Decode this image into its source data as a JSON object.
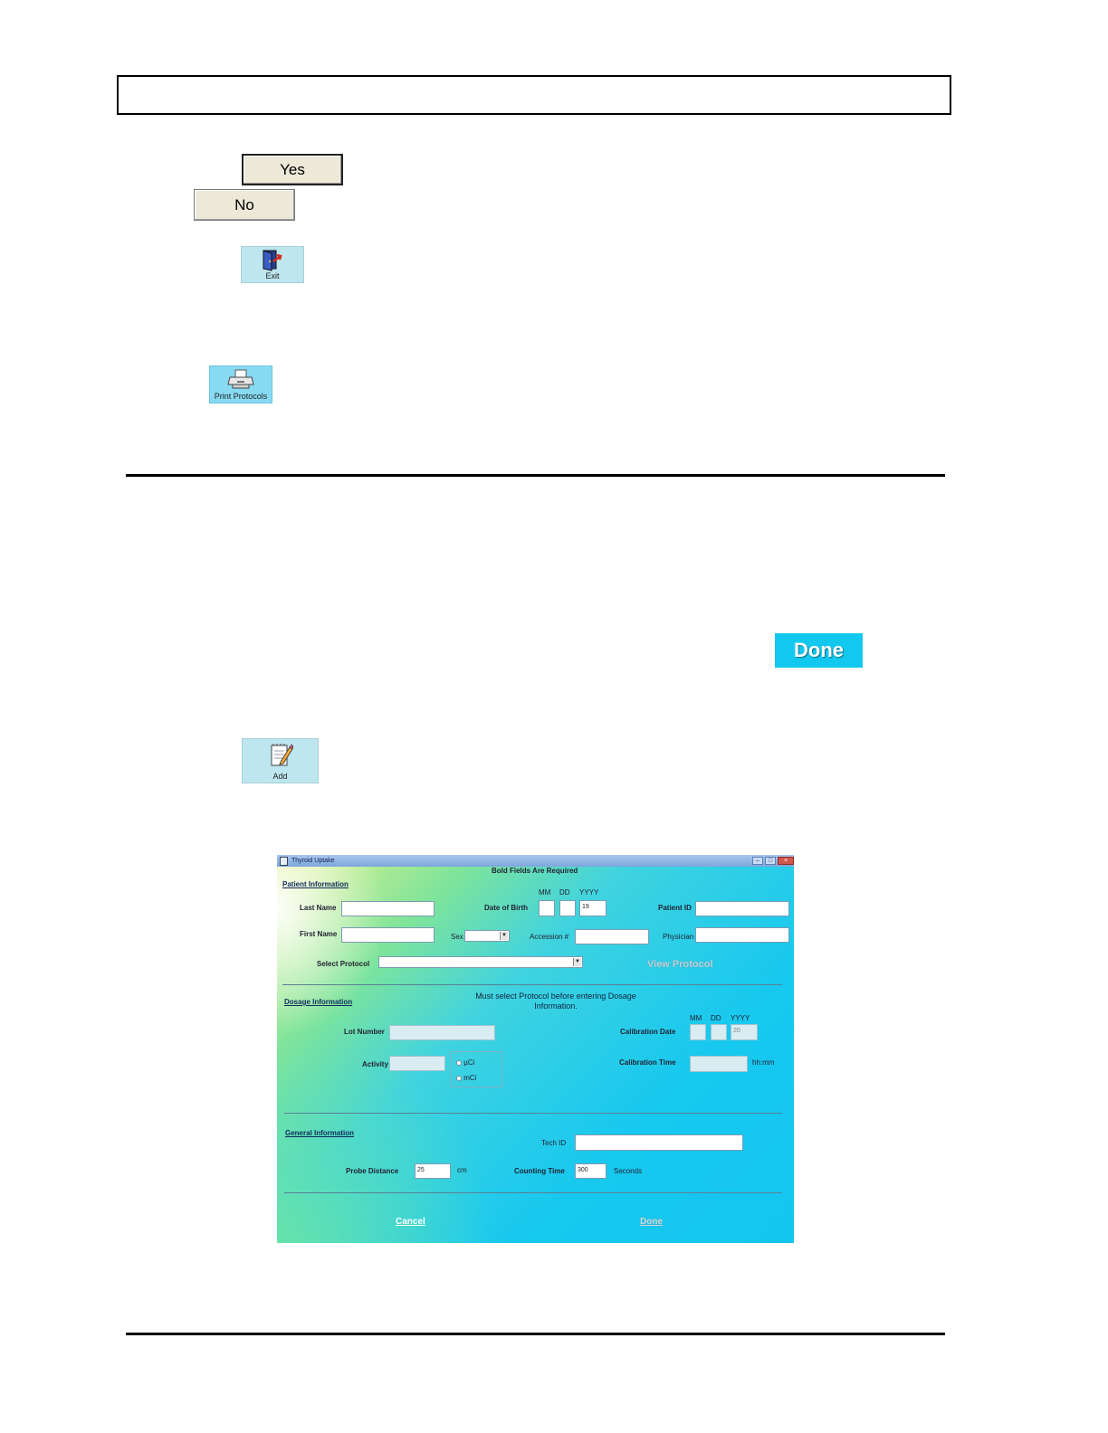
{
  "buttons": {
    "yes": "Yes",
    "no": "No",
    "exit": "Exit",
    "print_protocols": "Print Protocols",
    "done": "Done",
    "add": "Add"
  },
  "dialog": {
    "title": "Thyroid Uptake",
    "required_note": "Bold Fields Are Required",
    "patient_section": "Patient Information",
    "last_name_label": "Last Name",
    "first_name_label": "First Name",
    "dob_label": "Date of Birth",
    "mm": "MM",
    "dd": "DD",
    "yyyy": "YYYY",
    "dob_year_value": "19",
    "patient_id_label": "Patient ID",
    "sex_label": "Sex",
    "accession_label": "Accession #",
    "physician_label": "Physician",
    "select_protocol_label": "Select Protocol",
    "view_protocol": "View Protocol",
    "dosage_section": "Dosage Information",
    "dosage_note": "Must select Protocol before entering Dosage Information.",
    "lot_number_label": "Lot Number",
    "calibration_date_label": "Calibration Date",
    "cal_year_value": "20",
    "activity_label": "Activity",
    "uci": "µCi",
    "mci": "mCi",
    "calibration_time_label": "Calibration Time",
    "hhmm": "hh:mm",
    "general_section": "General Information",
    "tech_id_label": "Tech ID",
    "probe_distance_label": "Probe Distance",
    "probe_distance_value": "25",
    "cm": "cm",
    "counting_time_label": "Counting Time",
    "counting_time_value": "300",
    "seconds": "Seconds",
    "cancel": "Cancel",
    "done": "Done"
  }
}
